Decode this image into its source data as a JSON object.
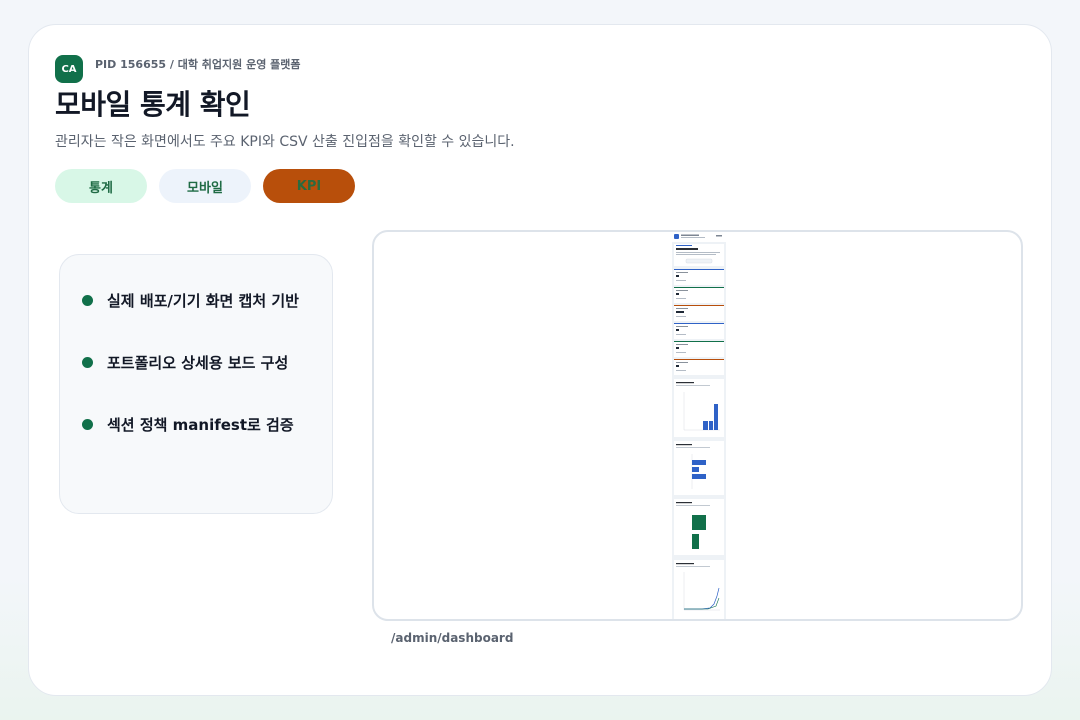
{
  "header": {
    "logo_text": "CA",
    "pid": "PID 156655 / 대학 취업지원 운영 플랫폼",
    "title": "모바일 통계 확인",
    "subtitle": "관리자는 작은 화면에서도 주요 KPI와 CSV 산출 진입점을 확인할 수 있습니다."
  },
  "chips": [
    "통계",
    "모바일",
    "KPI"
  ],
  "features": [
    "실제 배포/기기 화면 캡처 기반",
    "포트폴리오 상세용 보드 구성",
    "섹션 정책 manifest로 검증"
  ],
  "screenshot": {
    "caption": "/admin/dashboard"
  },
  "colors": {
    "brand": "#11704a",
    "accent": "#b84f0b",
    "bar_blue": "#2f62c7"
  }
}
